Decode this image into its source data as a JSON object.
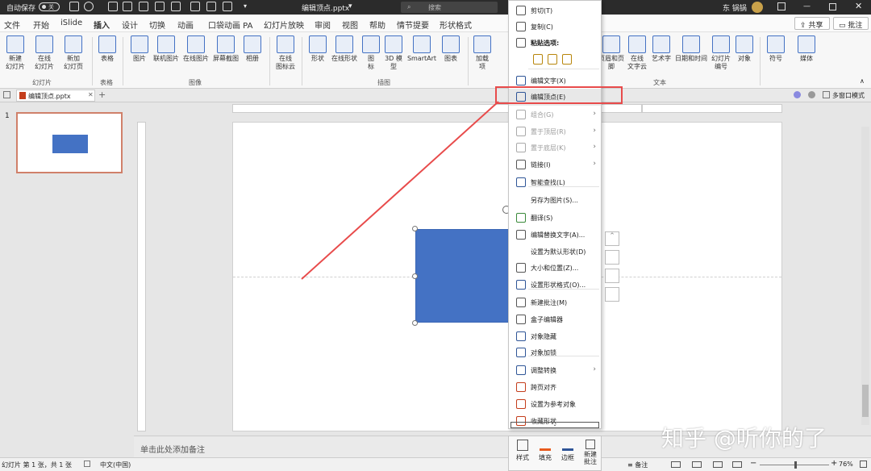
{
  "titlebar": {
    "autosave": "自动保存",
    "toggle": "关",
    "filename": "编辑顶点.pptx",
    "search_placeholder": "搜索",
    "user": "东 锅锅"
  },
  "menubar": {
    "tabs": [
      "文件",
      "开始",
      "iSlide",
      "插入",
      "设计",
      "切换",
      "动画",
      "口袋动画 PA",
      "幻灯片放映",
      "审阅",
      "视图",
      "帮助",
      "情节提要",
      "形状格式"
    ],
    "active_index": 3,
    "share": "共享",
    "comment": "批注"
  },
  "ribbon": {
    "buttons_left": [
      "新建\n幻灯片",
      "在线\n幻灯片",
      "新加\n幻灯页"
    ],
    "group_slides": "幻灯片",
    "btn_table": "表格",
    "group_table": "表格",
    "images": [
      "图片",
      "联机图片",
      "在线图片",
      "屏幕截图",
      "相册"
    ],
    "group_images": "图像",
    "btn_online_icon": "在线\n图标云",
    "illus": [
      "形状",
      "在线形状",
      "图\n标",
      "3D 模\n型",
      "SmartArt",
      "图表"
    ],
    "group_illus": "插图",
    "btn_addin": "加载\n项",
    "text_btns": [
      "页眉和页脚",
      "在线\n文字云",
      "艺术字",
      "日期和时间",
      "幻灯片\n编号",
      "对象"
    ],
    "group_text": "文本",
    "btn_symbol": "符号",
    "btn_media": "媒体"
  },
  "doctab": {
    "name": "编辑顶点.pptx",
    "right": "多窗口模式"
  },
  "thumb": {
    "number": "1"
  },
  "notes": {
    "placeholder": "单击此处添加备注"
  },
  "status": {
    "slide_info": "幻灯片 第 1 张，共 1 张",
    "lang": "中文(中国)",
    "notes_btn": "备注",
    "zoom": "76%"
  },
  "context_menu": {
    "items": [
      {
        "label": "剪切(T)",
        "icon": "scissors-icon"
      },
      {
        "label": "复制(C)",
        "icon": "copy-icon"
      },
      {
        "label": "粘贴选项:",
        "icon": "paste-icon",
        "bold": true
      },
      {
        "label": "编辑文字(X)",
        "icon": "text-edit-icon"
      },
      {
        "label": "编辑顶点(E)",
        "icon": "edit-points-icon",
        "highlight": true
      },
      {
        "label": "组合(G)",
        "icon": "group-icon",
        "disabled": true,
        "sub": true
      },
      {
        "label": "置于顶层(R)",
        "icon": "bring-front-icon",
        "disabled": true,
        "sub": true
      },
      {
        "label": "置于底层(K)",
        "icon": "send-back-icon",
        "disabled": true,
        "sub": true
      },
      {
        "label": "链接(I)",
        "icon": "link-icon",
        "sub": true
      },
      {
        "label": "智能查找(L)",
        "icon": "smart-lookup-icon"
      },
      {
        "label": "另存为图片(S)...",
        "icon": ""
      },
      {
        "label": "翻译(S)",
        "icon": "translate-icon"
      },
      {
        "label": "编辑替换文字(A)...",
        "icon": "alt-text-icon"
      },
      {
        "label": "设置为默认形状(D)",
        "icon": ""
      },
      {
        "label": "大小和位置(Z)...",
        "icon": "size-position-icon"
      },
      {
        "label": "设置形状格式(O)...",
        "icon": "format-shape-icon"
      },
      {
        "label": "新建批注(M)",
        "icon": "new-comment-icon"
      },
      {
        "label": "盒子编辑器",
        "icon": "box-editor-icon"
      },
      {
        "label": "对象隐藏",
        "icon": "hide-object-icon"
      },
      {
        "label": "对象加锁",
        "icon": "lock-object-icon"
      },
      {
        "label": "调整转换",
        "icon": "convert-icon",
        "sub": true
      },
      {
        "label": "跨页对齐",
        "icon": "align-pages-icon"
      },
      {
        "label": "设置为参考对象",
        "icon": "reference-icon"
      },
      {
        "label": "收藏形状",
        "icon": "favorite-shape-icon"
      }
    ]
  },
  "mini_toolbar": {
    "style": "样式",
    "fill": "填充",
    "outline": "边框",
    "comment": "新建\n批注"
  },
  "watermark": "知乎 @听你的了",
  "colors": {
    "shape": "#4472c4",
    "accent": "#c43e1c",
    "highlight": "#e84b4b"
  }
}
